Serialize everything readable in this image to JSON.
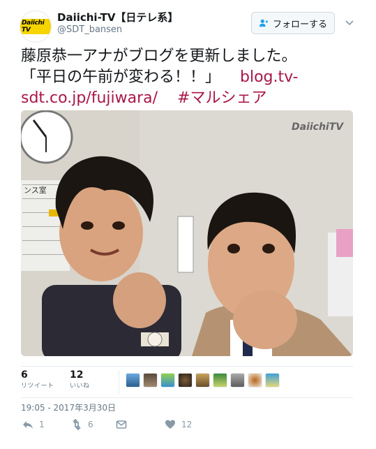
{
  "header": {
    "avatar_text": "Daiichi TV",
    "display_name": "Daiichi-TV【日テレ系】",
    "handle": "@SDT_bansen",
    "follow_label": "フォローする"
  },
  "tweet": {
    "text_line1": "藤原恭一アナがブログを更新しました。",
    "text_line2": "「平日の午前が変わる！！」",
    "link1": "blog.tv-sdt.co.jp/fujiwara/",
    "hashtag": "#マルシェア"
  },
  "photo": {
    "watermark": "DaiichiTV",
    "sign_text": "ンス室"
  },
  "stats": {
    "retweets_count": "6",
    "retweets_label": "リツイート",
    "likes_count": "12",
    "likes_label": "いいね"
  },
  "timestamp": "19:05 - 2017年3月30日",
  "actions": {
    "reply_count": "1",
    "retweet_count": "6",
    "like_count": "12"
  },
  "colors": {
    "link": "#a8174a",
    "muted": "#657786"
  },
  "icons": [
    "person-add-icon",
    "chevron-down-icon",
    "reply-icon",
    "retweet-icon",
    "direct-message-icon",
    "heart-icon"
  ]
}
